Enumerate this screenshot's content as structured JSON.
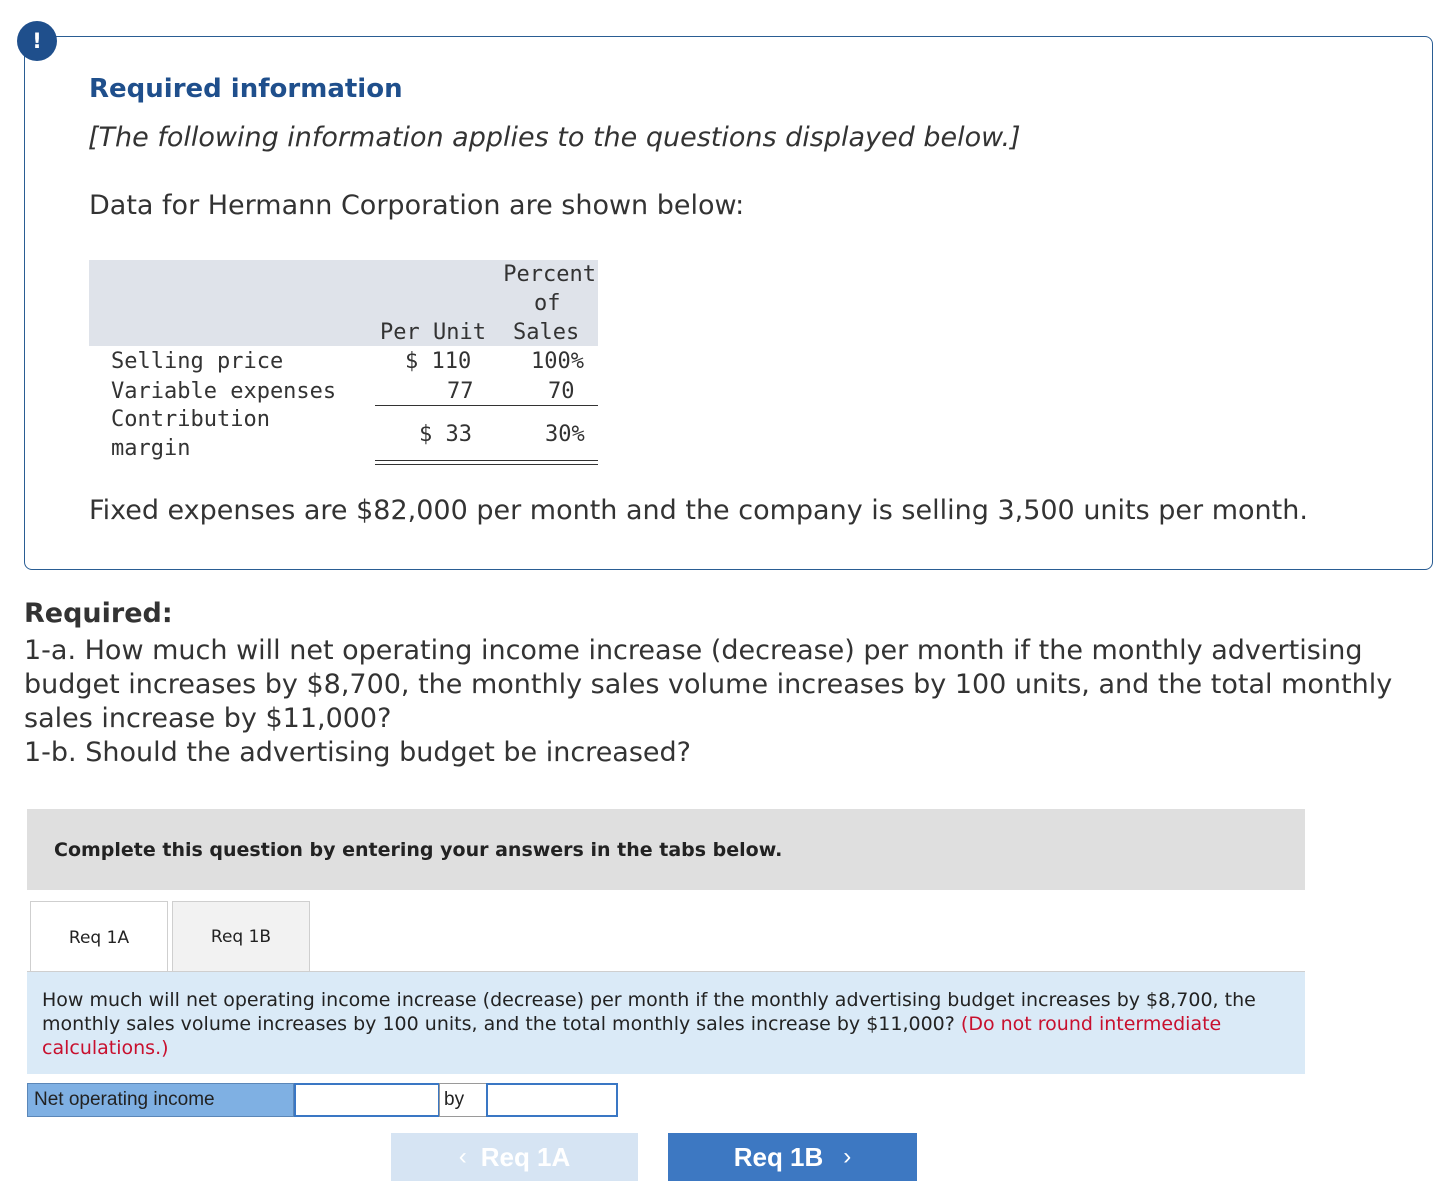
{
  "alert": {
    "icon": "!"
  },
  "info_box": {
    "title": "Required information",
    "note": "[The following information applies to the questions displayed below.]",
    "intro": "Data for Hermann Corporation are shown below:",
    "table": {
      "header": {
        "per_unit": "Per Unit",
        "percent_line1": "Percent",
        "percent_line2": "of",
        "percent_line3": "Sales"
      },
      "rows": [
        {
          "label": "Selling price",
          "per_unit": "$ 110",
          "percent": "100%"
        },
        {
          "label": "Variable expenses",
          "per_unit": "77",
          "percent": "70"
        },
        {
          "label_line1": "Contribution",
          "label_line2": "margin",
          "per_unit": "$ 33",
          "percent": "30%"
        }
      ]
    },
    "fixed_expenses": "Fixed expenses are $82,000 per month and the company is selling 3,500 units per month."
  },
  "required": {
    "title": "Required:",
    "line_1a": "1-a. How much will net operating income increase (decrease) per month if the monthly advertising budget increases by $8,700, the monthly sales volume increases by 100 units, and the total monthly sales increase by $11,000?",
    "line_1b": "1-b. Should the advertising budget be increased?"
  },
  "instruction": "Complete this question by entering your answers in the tabs below.",
  "tabs": [
    {
      "label": "Req 1A",
      "active": true
    },
    {
      "label": "Req 1B",
      "active": false
    }
  ],
  "question": {
    "text": "How much will net operating income increase (decrease) per month if the monthly advertising budget increases by $8,700, the monthly sales volume increases by 100 units, and the total monthly sales increase by $11,000?",
    "hint": "(Do not round intermediate calculations.)"
  },
  "answer": {
    "label": "Net operating income",
    "select_value": "",
    "by_label": "by",
    "amount_value": ""
  },
  "nav": {
    "prev_label": "Req 1A",
    "next_label": "Req 1B",
    "prev_icon": "chevron-left",
    "next_icon": "chevron-right"
  },
  "colors": {
    "brand_blue": "#1f4f8c",
    "button_blue": "#3d78c2",
    "hint_red": "#c8102e"
  }
}
